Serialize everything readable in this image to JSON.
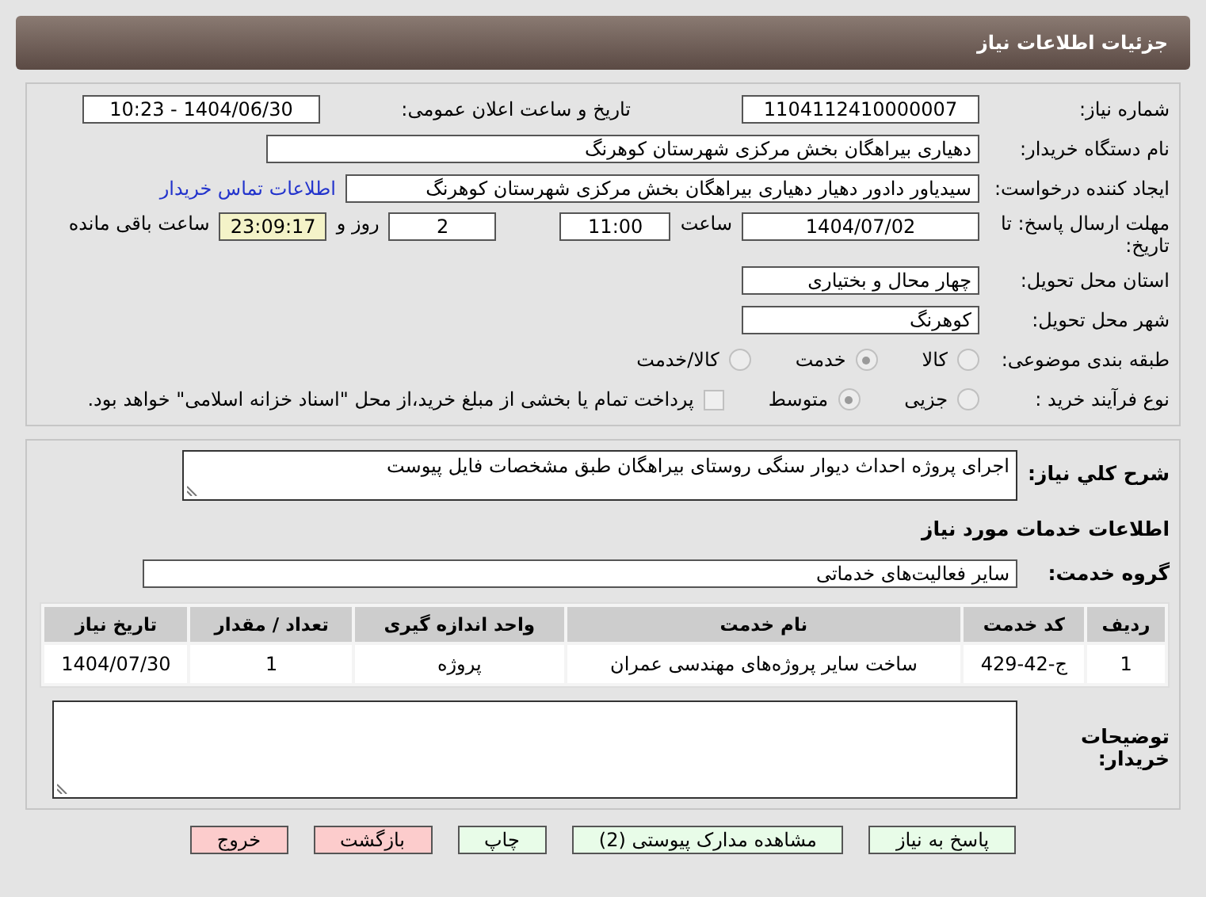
{
  "header": {
    "title": "جزئیات اطلاعات نیاز"
  },
  "details": {
    "need_number": {
      "label": "شماره نیاز:",
      "value": "1104112410000007"
    },
    "announce": {
      "label": "تاریخ و ساعت اعلان عمومی:",
      "value": "1404/06/30 - 10:23"
    },
    "buyer": {
      "label": "نام دستگاه خریدار:",
      "value": "دهیاری بیراهگان بخش مرکزی شهرستان کوهرنگ"
    },
    "creator": {
      "label": "ایجاد کننده درخواست:",
      "value": "سیدیاور دادور دهیار دهیاری بیراهگان بخش مرکزی شهرستان کوهرنگ",
      "link": "اطلاعات تماس خریدار"
    },
    "deadline": {
      "label": "مهلت ارسال پاسخ: تا تاریخ:",
      "date": "1404/07/02",
      "time_label": "ساعت",
      "time": "11:00",
      "days": "2",
      "days_label": "روز و",
      "remaining": "23:09:17",
      "remaining_label": "ساعت باقی مانده"
    },
    "province": {
      "label": "استان محل تحویل:",
      "value": "چهار محال و بختیاری"
    },
    "city": {
      "label": "شهر محل تحویل:",
      "value": "کوهرنگ"
    },
    "category": {
      "label": "طبقه بندی موضوعی:",
      "options": [
        {
          "label": "کالا",
          "selected": false
        },
        {
          "label": "خدمت",
          "selected": true
        },
        {
          "label": "کالا/خدمت",
          "selected": false
        }
      ]
    },
    "process": {
      "label": "نوع فرآیند خرید :",
      "options": [
        {
          "label": "جزیی",
          "selected": false
        },
        {
          "label": "متوسط",
          "selected": true
        }
      ],
      "payment": {
        "checked": false,
        "text": "پرداخت تمام یا بخشی از مبلغ خرید،از محل \"اسناد خزانه اسلامی\" خواهد بود."
      }
    }
  },
  "services": {
    "description": {
      "label": "شرح کلي نياز:",
      "value": "اجرای پروژه احداث دیوار سنگی روستای بیراهگان طبق مشخصات فایل پیوست"
    },
    "heading": "اطلاعات خدمات مورد نیاز",
    "group": {
      "label": "گروه خدمت:",
      "value": "سایر فعالیت‌های خدماتی"
    },
    "table": {
      "columns": [
        "ردیف",
        "کد خدمت",
        "نام خدمت",
        "واحد اندازه گیری",
        "تعداد / مقدار",
        "تاریخ نیاز"
      ],
      "rows": [
        [
          "1",
          "ج-42-429",
          "ساخت سایر پروژه‌های مهندسی عمران",
          "پروژه",
          "1",
          "1404/07/30"
        ]
      ]
    },
    "notes": {
      "label": "توضیحات خریدار:"
    }
  },
  "buttons": [
    {
      "label": "پاسخ به نیاز",
      "kind": "green"
    },
    {
      "label": "مشاهده مدارک پیوستی (2)",
      "kind": "green"
    },
    {
      "label": "چاپ",
      "kind": "green"
    },
    {
      "label": "بازگشت",
      "kind": "red"
    },
    {
      "label": "خروج",
      "kind": "red"
    }
  ]
}
